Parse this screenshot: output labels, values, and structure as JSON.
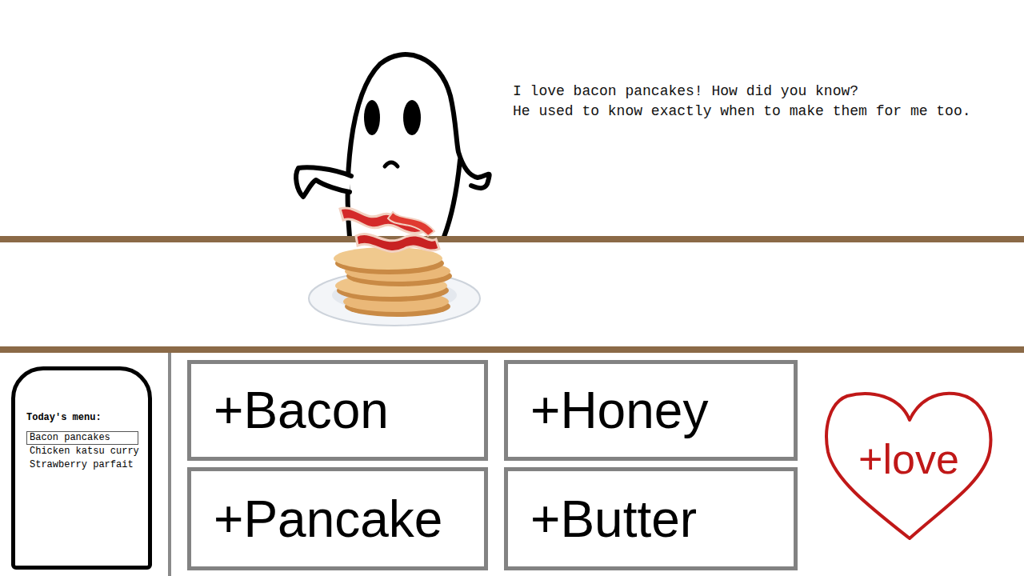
{
  "dialogue": {
    "lines": [
      "I love bacon pancakes! How did you know?",
      "He used to know exactly when to make them for me too."
    ]
  },
  "menu": {
    "title": "Today's menu:",
    "items": [
      {
        "label": "Bacon pancakes",
        "selected": true
      },
      {
        "label": "Chicken katsu curry",
        "selected": false
      },
      {
        "label": "Strawberry parfait",
        "selected": false
      }
    ]
  },
  "ingredients": [
    {
      "label": "+Bacon"
    },
    {
      "label": "+Honey"
    },
    {
      "label": "+Pancake"
    },
    {
      "label": "+Butter"
    }
  ],
  "love_button": {
    "label": "+love"
  }
}
